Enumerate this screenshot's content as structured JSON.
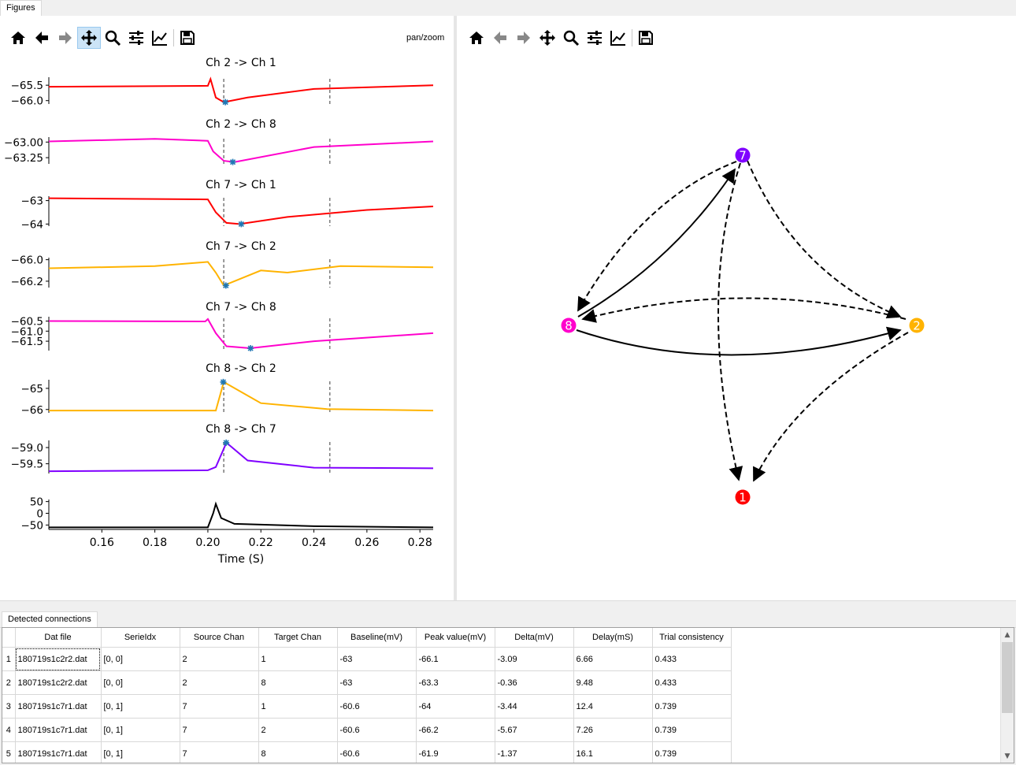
{
  "tabs": {
    "figures": "Figures"
  },
  "left_toolbar": {
    "icons": [
      "home-icon",
      "back-arrow-icon",
      "forward-arrow-icon",
      "pan-icon",
      "zoom-icon",
      "configure-subplots-icon",
      "edit-axes-icon",
      "save-icon"
    ],
    "mode": "pan/zoom"
  },
  "right_toolbar": {
    "icons": [
      "home-icon",
      "back-arrow-icon",
      "forward-arrow-icon",
      "pan-icon",
      "zoom-icon",
      "configure-subplots-icon",
      "edit-axes-icon",
      "save-icon"
    ]
  },
  "colors": {
    "red": "#ff0000",
    "magenta": "#ff00cc",
    "orange": "#ffb300",
    "purple": "#8000ff",
    "marker": "#1f77b4",
    "dash": "#808080"
  },
  "chart_data": [
    {
      "type": "line",
      "title": "Ch 2 -> Ch 1",
      "yticks": [
        "−65.5",
        "−66.0"
      ],
      "color": "#ff0000",
      "xlim": [
        0.14,
        0.285
      ],
      "x": [
        0.14,
        0.2,
        0.201,
        0.203,
        0.206,
        0.215,
        0.24,
        0.285
      ],
      "y": [
        -65.55,
        -65.52,
        -65.3,
        -65.9,
        -66.05,
        -65.9,
        -65.62,
        -65.5
      ],
      "peak": [
        0.2066,
        -66.05
      ],
      "markers": [
        0.206,
        0.246
      ]
    },
    {
      "type": "line",
      "title": "Ch 2 -> Ch 8",
      "yticks": [
        "−63.00",
        "−63.25"
      ],
      "color": "#ff00cc",
      "xlim": [
        0.14,
        0.285
      ],
      "x": [
        0.14,
        0.18,
        0.2,
        0.202,
        0.206,
        0.21,
        0.24,
        0.285
      ],
      "y": [
        -62.99,
        -62.95,
        -62.98,
        -63.15,
        -63.3,
        -63.32,
        -63.08,
        -62.99
      ],
      "peak": [
        0.2094,
        -63.32
      ],
      "markers": [
        0.206,
        0.246
      ]
    },
    {
      "type": "line",
      "title": "Ch 7 -> Ch 1",
      "yticks": [
        "−63",
        "−64"
      ],
      "color": "#ff0000",
      "xlim": [
        0.14,
        0.285
      ],
      "x": [
        0.14,
        0.2,
        0.203,
        0.207,
        0.212,
        0.23,
        0.26,
        0.285
      ],
      "y": [
        -62.9,
        -62.95,
        -63.5,
        -63.95,
        -64.0,
        -63.7,
        -63.4,
        -63.25
      ],
      "peak": [
        0.2126,
        -64.0
      ],
      "markers": [
        0.206,
        0.246
      ]
    },
    {
      "type": "line",
      "title": "Ch 7 -> Ch 2",
      "yticks": [
        "−66.0",
        "−66.2"
      ],
      "color": "#ffb300",
      "xlim": [
        0.14,
        0.285
      ],
      "x": [
        0.14,
        0.18,
        0.2,
        0.203,
        0.206,
        0.21,
        0.22,
        0.23,
        0.25,
        0.285
      ],
      "y": [
        -66.08,
        -66.06,
        -66.02,
        -66.12,
        -66.24,
        -66.2,
        -66.1,
        -66.12,
        -66.06,
        -66.07
      ],
      "peak": [
        0.2068,
        -66.24
      ],
      "markers": [
        0.206,
        0.246
      ]
    },
    {
      "type": "line",
      "title": "Ch 7 -> Ch 8",
      "yticks": [
        "−60.5",
        "−61.0",
        "−61.5"
      ],
      "color": "#ff00cc",
      "xlim": [
        0.14,
        0.285
      ],
      "x": [
        0.14,
        0.199,
        0.2,
        0.203,
        0.207,
        0.216,
        0.24,
        0.285
      ],
      "y": [
        -60.5,
        -60.52,
        -60.4,
        -61.1,
        -61.75,
        -61.85,
        -61.5,
        -61.1
      ],
      "peak": [
        0.2161,
        -61.85
      ],
      "markers": [
        0.206,
        0.246
      ]
    },
    {
      "type": "line",
      "title": "Ch 8 -> Ch 2",
      "yticks": [
        "−65",
        "−66"
      ],
      "color": "#ffb300",
      "xlim": [
        0.14,
        0.285
      ],
      "x": [
        0.14,
        0.203,
        0.206,
        0.22,
        0.245,
        0.285
      ],
      "y": [
        -66.05,
        -66.05,
        -64.7,
        -65.7,
        -65.98,
        -66.05
      ],
      "peak": [
        0.2058,
        -64.7
      ],
      "markers": [
        0.206,
        0.246
      ]
    },
    {
      "type": "line",
      "title": "Ch 8 -> Ch 7",
      "yticks": [
        "−59.0",
        "−59.5"
      ],
      "color": "#8000ff",
      "xlim": [
        0.14,
        0.285
      ],
      "x": [
        0.14,
        0.2,
        0.203,
        0.207,
        0.215,
        0.24,
        0.285
      ],
      "y": [
        -59.73,
        -59.7,
        -59.6,
        -58.85,
        -59.4,
        -59.62,
        -59.64
      ],
      "peak": [
        0.2069,
        -58.85
      ],
      "markers": [
        0.206,
        0.246
      ]
    },
    {
      "type": "line",
      "title": "",
      "yticks": [
        "50",
        "0",
        "−50"
      ],
      "color": "#000000",
      "xlim": [
        0.14,
        0.285
      ],
      "x": [
        0.14,
        0.2,
        0.202,
        0.203,
        0.205,
        0.21,
        0.24,
        0.285
      ],
      "y": [
        -60,
        -60,
        0,
        40,
        -20,
        -45,
        -55,
        -60
      ],
      "xticks": [
        "0.16",
        "0.18",
        "0.20",
        "0.22",
        "0.24",
        "0.26",
        "0.28"
      ],
      "xlabel": "Time (S)"
    }
  ],
  "graph": {
    "nodes": [
      {
        "label": "7",
        "color": "#8000ff"
      },
      {
        "label": "8",
        "color": "#ff00cc"
      },
      {
        "label": "2",
        "color": "#ffb300"
      },
      {
        "label": "1",
        "color": "#ff0000"
      }
    ]
  },
  "bottom": {
    "tab": "Detected connections",
    "headers": [
      "Dat file",
      "SerieIdx",
      "Source Chan",
      "Target Chan",
      "Baseline(mV)",
      "Peak value(mV)",
      "Delta(mV)",
      "Delay(mS)",
      "Trial consistency"
    ],
    "rows": [
      [
        "1",
        "180719s1c2r2.dat",
        "[0, 0]",
        "2",
        "1",
        "-63",
        "-66.1",
        "-3.09",
        "6.66",
        "0.433"
      ],
      [
        "2",
        "180719s1c2r2.dat",
        "[0, 0]",
        "2",
        "8",
        "-63",
        "-63.3",
        "-0.36",
        "9.48",
        "0.433"
      ],
      [
        "3",
        "180719s1c7r1.dat",
        "[0, 1]",
        "7",
        "1",
        "-60.6",
        "-64",
        "-3.44",
        "12.4",
        "0.739"
      ],
      [
        "4",
        "180719s1c7r1.dat",
        "[0, 1]",
        "7",
        "2",
        "-60.6",
        "-66.2",
        "-5.67",
        "7.26",
        "0.739"
      ],
      [
        "5",
        "180719s1c7r1.dat",
        "[0, 1]",
        "7",
        "8",
        "-60.6",
        "-61.9",
        "-1.37",
        "16.1",
        "0.739"
      ]
    ]
  }
}
